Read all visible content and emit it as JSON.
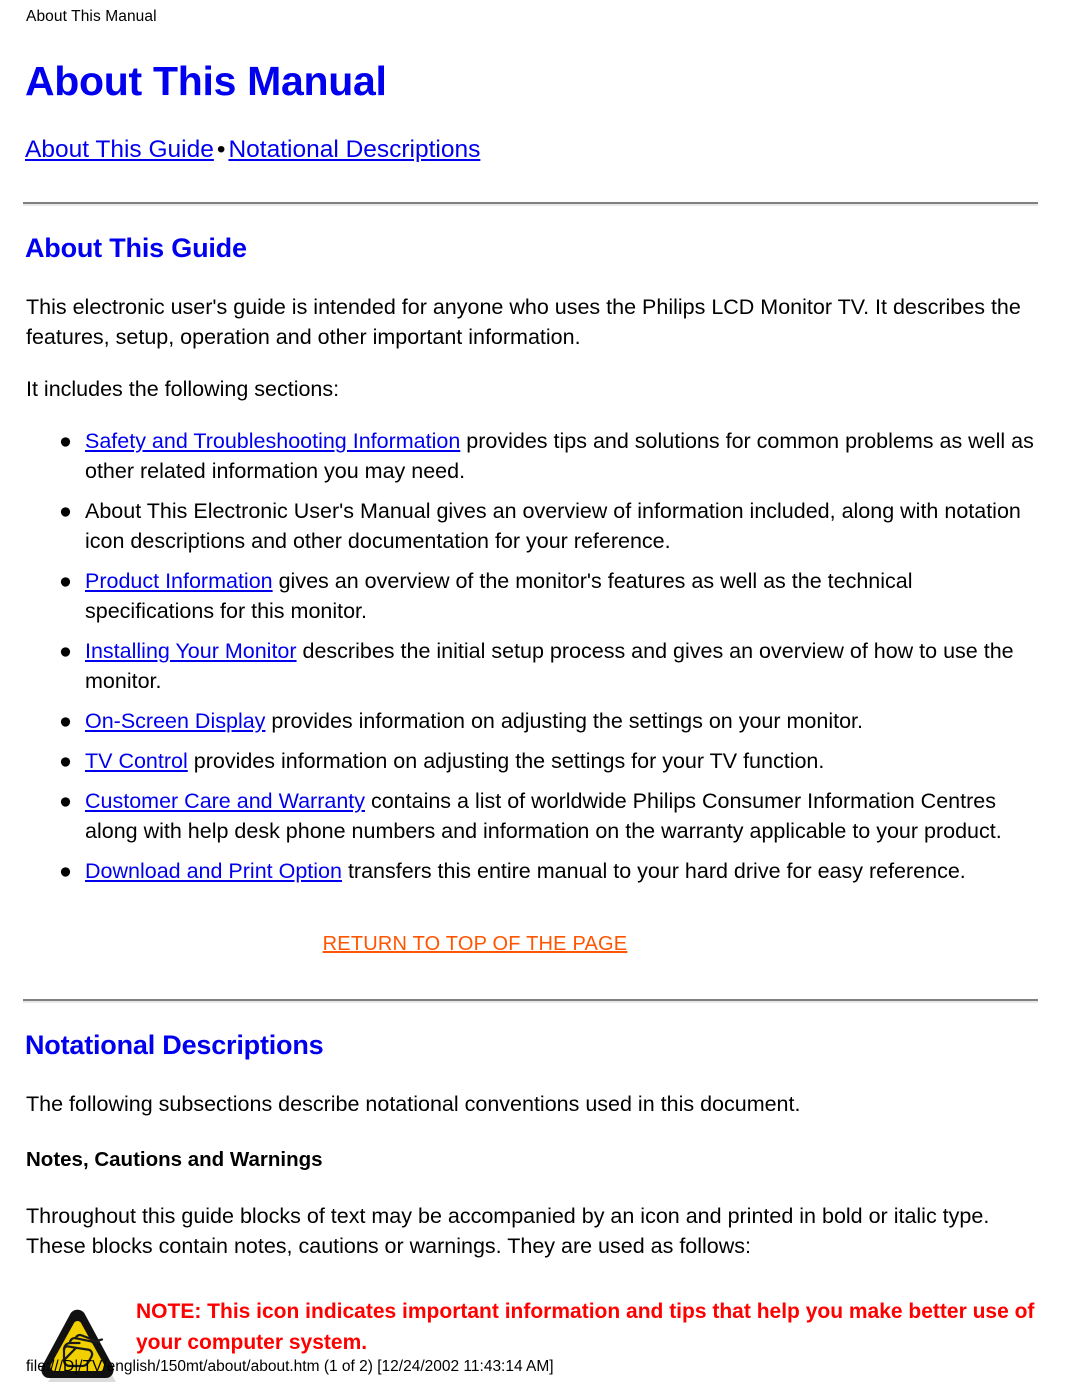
{
  "colors": {
    "link_blue": "#0000ee",
    "heading_blue": "#0000ee",
    "return_top_orange": "#ff5500",
    "note_red": "#ff0000",
    "rule_gray": "#808080",
    "icon_yellow": "#f2d000",
    "icon_black": "#000000"
  },
  "running_header": "About This Manual",
  "title": "About This Manual",
  "subnav": {
    "links": [
      "About This Guide",
      "Notational Descriptions"
    ],
    "separator": "•"
  },
  "sections": {
    "about_guide": {
      "heading": "About This Guide",
      "intro": "This electronic user's guide is intended for anyone who uses the Philips LCD Monitor TV. It describes the features, setup, operation and other important information.",
      "includes_line": "It includes the following sections:",
      "bullets": [
        {
          "link": "Safety and Troubleshooting Information",
          "text": " provides tips and solutions for common problems as well as other related information you may need."
        },
        {
          "link": "",
          "text": "About This Electronic User's Manual gives an overview of information included, along with notation icon descriptions and other documentation for your reference."
        },
        {
          "link": "Product Information",
          "text": " gives an overview of the monitor's features as well as the technical specifications for this monitor."
        },
        {
          "link": "Installing Your Monitor",
          "text": " describes the initial setup process and gives an overview of how to use the monitor."
        },
        {
          "link": "On-Screen Display",
          "text": " provides information on adjusting the settings on your monitor."
        },
        {
          "link": "TV Control",
          "text": " provides information on adjusting the settings for your TV function."
        },
        {
          "link": "Customer Care and Warranty",
          "text": " contains a list of worldwide Philips Consumer Information Centres along with help desk phone numbers and information on the warranty applicable to your product."
        },
        {
          "link": "Download and Print Option",
          "text": " transfers this entire manual to your hard drive for easy reference."
        }
      ],
      "return_to_top": "RETURN TO TOP OF THE PAGE"
    },
    "notational": {
      "heading": "Notational Descriptions",
      "intro": "The following subsections describe notational conventions used in this document.",
      "sub_heading": "Notes, Cautions and Warnings",
      "body": "Throughout this guide blocks of text may be accompanied by an icon and printed in bold or italic type. These blocks contain notes, cautions or warnings. They are used as follows:",
      "note": {
        "icon_name": "warning-triangle-note-icon",
        "text": "NOTE: This icon indicates important information and tips that help you make better use of your computer system."
      }
    }
  },
  "footer": "file:///D|/TV/english/150mt/about/about.htm (1 of 2) [12/24/2002 11:43:14 AM]"
}
